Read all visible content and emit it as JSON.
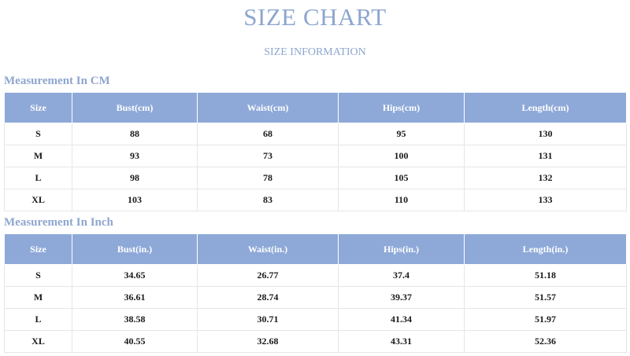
{
  "title": "SIZE CHART",
  "subtitle": "SIZE INFORMATION",
  "cm": {
    "heading": "Measurement In CM",
    "columns": [
      "Size",
      "Bust(cm)",
      "Waist(cm)",
      "Hips(cm)",
      "Length(cm)"
    ],
    "rows": [
      [
        "S",
        "88",
        "68",
        "95",
        "130"
      ],
      [
        "M",
        "93",
        "73",
        "100",
        "131"
      ],
      [
        "L",
        "98",
        "78",
        "105",
        "132"
      ],
      [
        "XL",
        "103",
        "83",
        "110",
        "133"
      ]
    ]
  },
  "inch": {
    "heading": "Measurement In Inch",
    "columns": [
      "Size",
      "Bust(in.)",
      "Waist(in.)",
      "Hips(in.)",
      "Length(in.)"
    ],
    "rows": [
      [
        "S",
        "34.65",
        "26.77",
        "37.4",
        "51.18"
      ],
      [
        "M",
        "36.61",
        "28.74",
        "39.37",
        "51.57"
      ],
      [
        "L",
        "38.58",
        "30.71",
        "41.34",
        "51.97"
      ],
      [
        "XL",
        "40.55",
        "32.68",
        "43.31",
        "52.36"
      ]
    ]
  },
  "colors": {
    "accent": "#8ea6cf",
    "header_fill": "#8ea9d8",
    "header_text": "#ffffff",
    "cell_text": "#1a1a1a"
  }
}
